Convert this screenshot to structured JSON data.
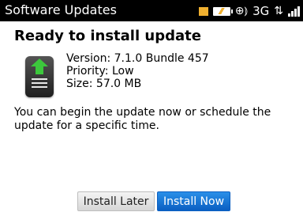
{
  "status_bar": {
    "app_title": "Software Updates",
    "network_type": "3G",
    "icons": [
      "mail-icon",
      "battery-charging-icon",
      "wifi-icon",
      "signal-icon"
    ]
  },
  "content": {
    "heading": "Ready to install update",
    "version_line": "Version: 7.1.0 Bundle 457",
    "priority_line": "Priority: Low",
    "size_line": "Size: 57.0 MB",
    "description": "You can begin the update now or schedule the update for a specific time.",
    "icon": "software-update-icon"
  },
  "buttons": {
    "install_later": "Install Later",
    "install_now": "Install Now"
  },
  "colors": {
    "status_bar_bg": "#000000",
    "accent_blue": "#0a6fd6",
    "update_arrow_green": "#3cc83c"
  }
}
